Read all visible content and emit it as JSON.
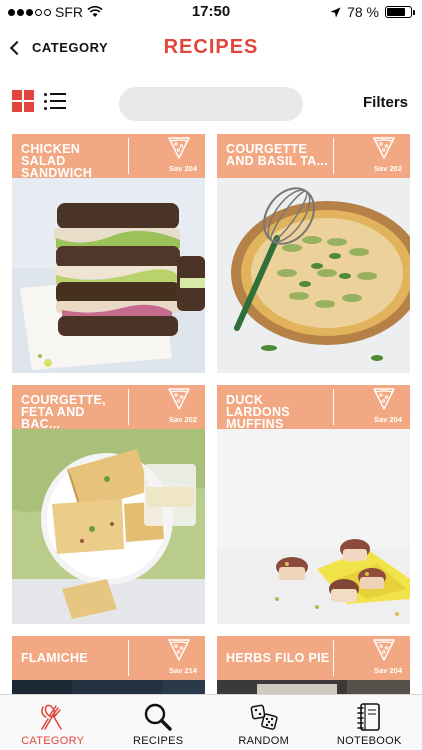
{
  "status_bar": {
    "carrier": "SFR",
    "time": "17:50",
    "battery": "78 %",
    "battery_level": 0.78
  },
  "nav": {
    "back_label": "CATEGORY",
    "title": "RECIPES"
  },
  "toolbar": {
    "search_placeholder": "",
    "search_value": "",
    "filters_label": "Filters"
  },
  "recipes": [
    {
      "title": "CHICKEN SALAD SANDWICH",
      "code": "Sav 204"
    },
    {
      "title": "COURGETTE AND BASIL TA...",
      "code": "Sav 202"
    },
    {
      "title": "COURGETTE, FETA AND BAC...",
      "code": "Sav 202"
    },
    {
      "title": "DUCK LARDONS MUFFINS",
      "code": "Sav 204"
    },
    {
      "title": "FLAMICHE",
      "code": "Sav 214"
    },
    {
      "title": "HERBS FILO PIE",
      "code": "Sav 204"
    }
  ],
  "tabs": [
    {
      "label": "CATEGORY",
      "icon": "kitchen-utensils-icon",
      "active": true
    },
    {
      "label": "RECIPES",
      "icon": "magnifier-icon",
      "active": false
    },
    {
      "label": "RANDOM",
      "icon": "dice-icon",
      "active": false
    },
    {
      "label": "NOTEBOOK",
      "icon": "notebook-icon",
      "active": false
    }
  ],
  "colors": {
    "accent": "#e0463c",
    "card_header": "#f2a882"
  }
}
